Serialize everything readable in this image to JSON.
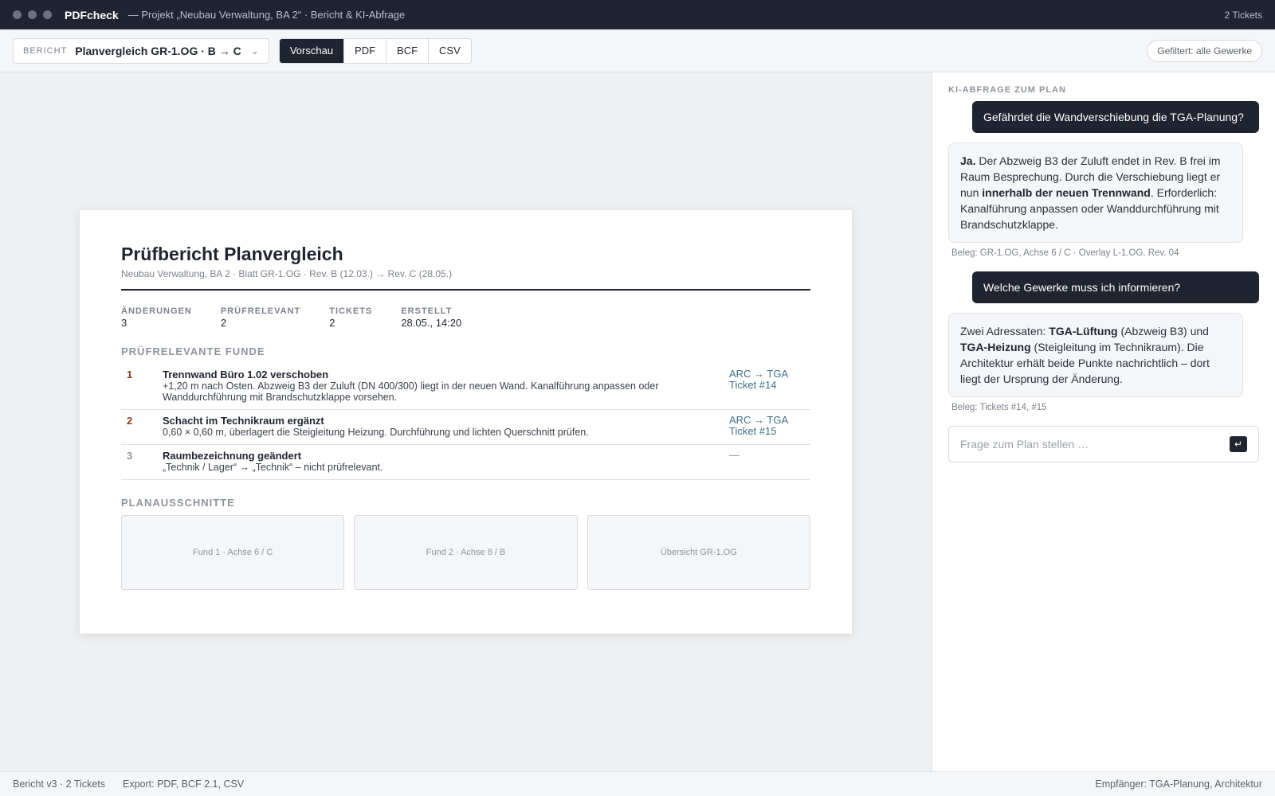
{
  "window": {
    "app_name": "PDFcheck",
    "title": "— Projekt „Neubau Verwaltung, BA 2“ · Bericht & KI-Abfrage",
    "tickets": "2 Tickets"
  },
  "toolbar": {
    "report_label": "BERICHT",
    "report_value": "Planvergleich GR-1.OG · B → C",
    "tabs": [
      {
        "label": "Vorschau",
        "active": true
      },
      {
        "label": "PDF",
        "active": false
      },
      {
        "label": "BCF",
        "active": false
      },
      {
        "label": "CSV",
        "active": false
      }
    ],
    "filter": "Gefiltert: alle Gewerke"
  },
  "doc": {
    "title": "Prüfbericht Planvergleich",
    "subtitle": "Neubau Verwaltung, BA 2 · Blatt GR-1.OG · Rev. B (12.03.) → Rev. C (28.05.)",
    "stats": [
      {
        "label": "ÄNDERUNGEN",
        "value": "3"
      },
      {
        "label": "PRÜFRELEVANT",
        "value": "2"
      },
      {
        "label": "TICKETS",
        "value": "2"
      },
      {
        "label": "ERSTELLT",
        "value": "28.05., 14:20"
      }
    ],
    "findings_title": "PRÜFRELEVANTE FUNDE",
    "findings": [
      {
        "num": "1",
        "title": "Trennwand Büro 1.02 verschoben",
        "desc": "+1,20 m nach Osten. Abzweig B3 der Zuluft (DN 400/300) liegt in der neuen Wand. Kanalführung anpassen oder Wanddurchführung mit Brandschutzklappe vorsehen.",
        "route": "ARC → TGA",
        "ticket": "Ticket #14"
      },
      {
        "num": "2",
        "title": "Schacht im Technikraum ergänzt",
        "desc": "0,60 × 0,60 m, überlagert die Steigleitung Heizung. Durchführung und lichten Querschnitt prüfen.",
        "route": "ARC → TGA",
        "ticket": "Ticket #15"
      },
      {
        "num": "3",
        "title": "Raumbezeichnung geändert",
        "desc": "„Technik / Lager“ → „Technik“ – nicht prüfrelevant.",
        "route": "—",
        "ticket": ""
      }
    ],
    "plans_title": "PLANAUSSCHNITTE",
    "plans": [
      "Fund 1 · Achse 6 / C",
      "Fund 2 · Achse 8 / B",
      "Übersicht GR-1.OG"
    ]
  },
  "side": {
    "title": "KI-ABFRAGE ZUM PLAN",
    "q1": "Gefährdet die Wandverschiebung die TGA-Planung?",
    "a1": {
      "b1": "Ja.",
      "t1": " Der Abzweig B3 der Zuluft endet in Rev. B frei im Raum Besprechung. Durch die Verschiebung liegt er nun ",
      "b2": "innerhalb der neuen Trennwand",
      "t2": ". Erforderlich: Kanalführung anpassen oder Wanddurchführung mit Brandschutzklappe."
    },
    "ref1": "Beleg: GR-1.OG, Achse 6 / C · Overlay L-1.OG, Rev. 04",
    "q2": "Welche Gewerke muss ich informieren?",
    "a2": {
      "t1": "Zwei Adressaten: ",
      "b1": "TGA-Lüftung",
      "t2": " (Abzweig B3) und ",
      "b2": "TGA-Heizung",
      "t3": " (Steigleitung im Technikraum). Die Architektur erhält beide Punkte nachrichtlich – dort liegt der Ursprung der Änderung."
    },
    "ref2": "Beleg: Tickets #14, #15",
    "input_placeholder": "Frage zum Plan stellen …",
    "send_glyph": "↵"
  },
  "status": {
    "left": "Bericht v3 · 2 Tickets",
    "middle": "Export: PDF, BCF 2.1, CSV",
    "right": "Empfänger: TGA-Planung, Architektur"
  }
}
